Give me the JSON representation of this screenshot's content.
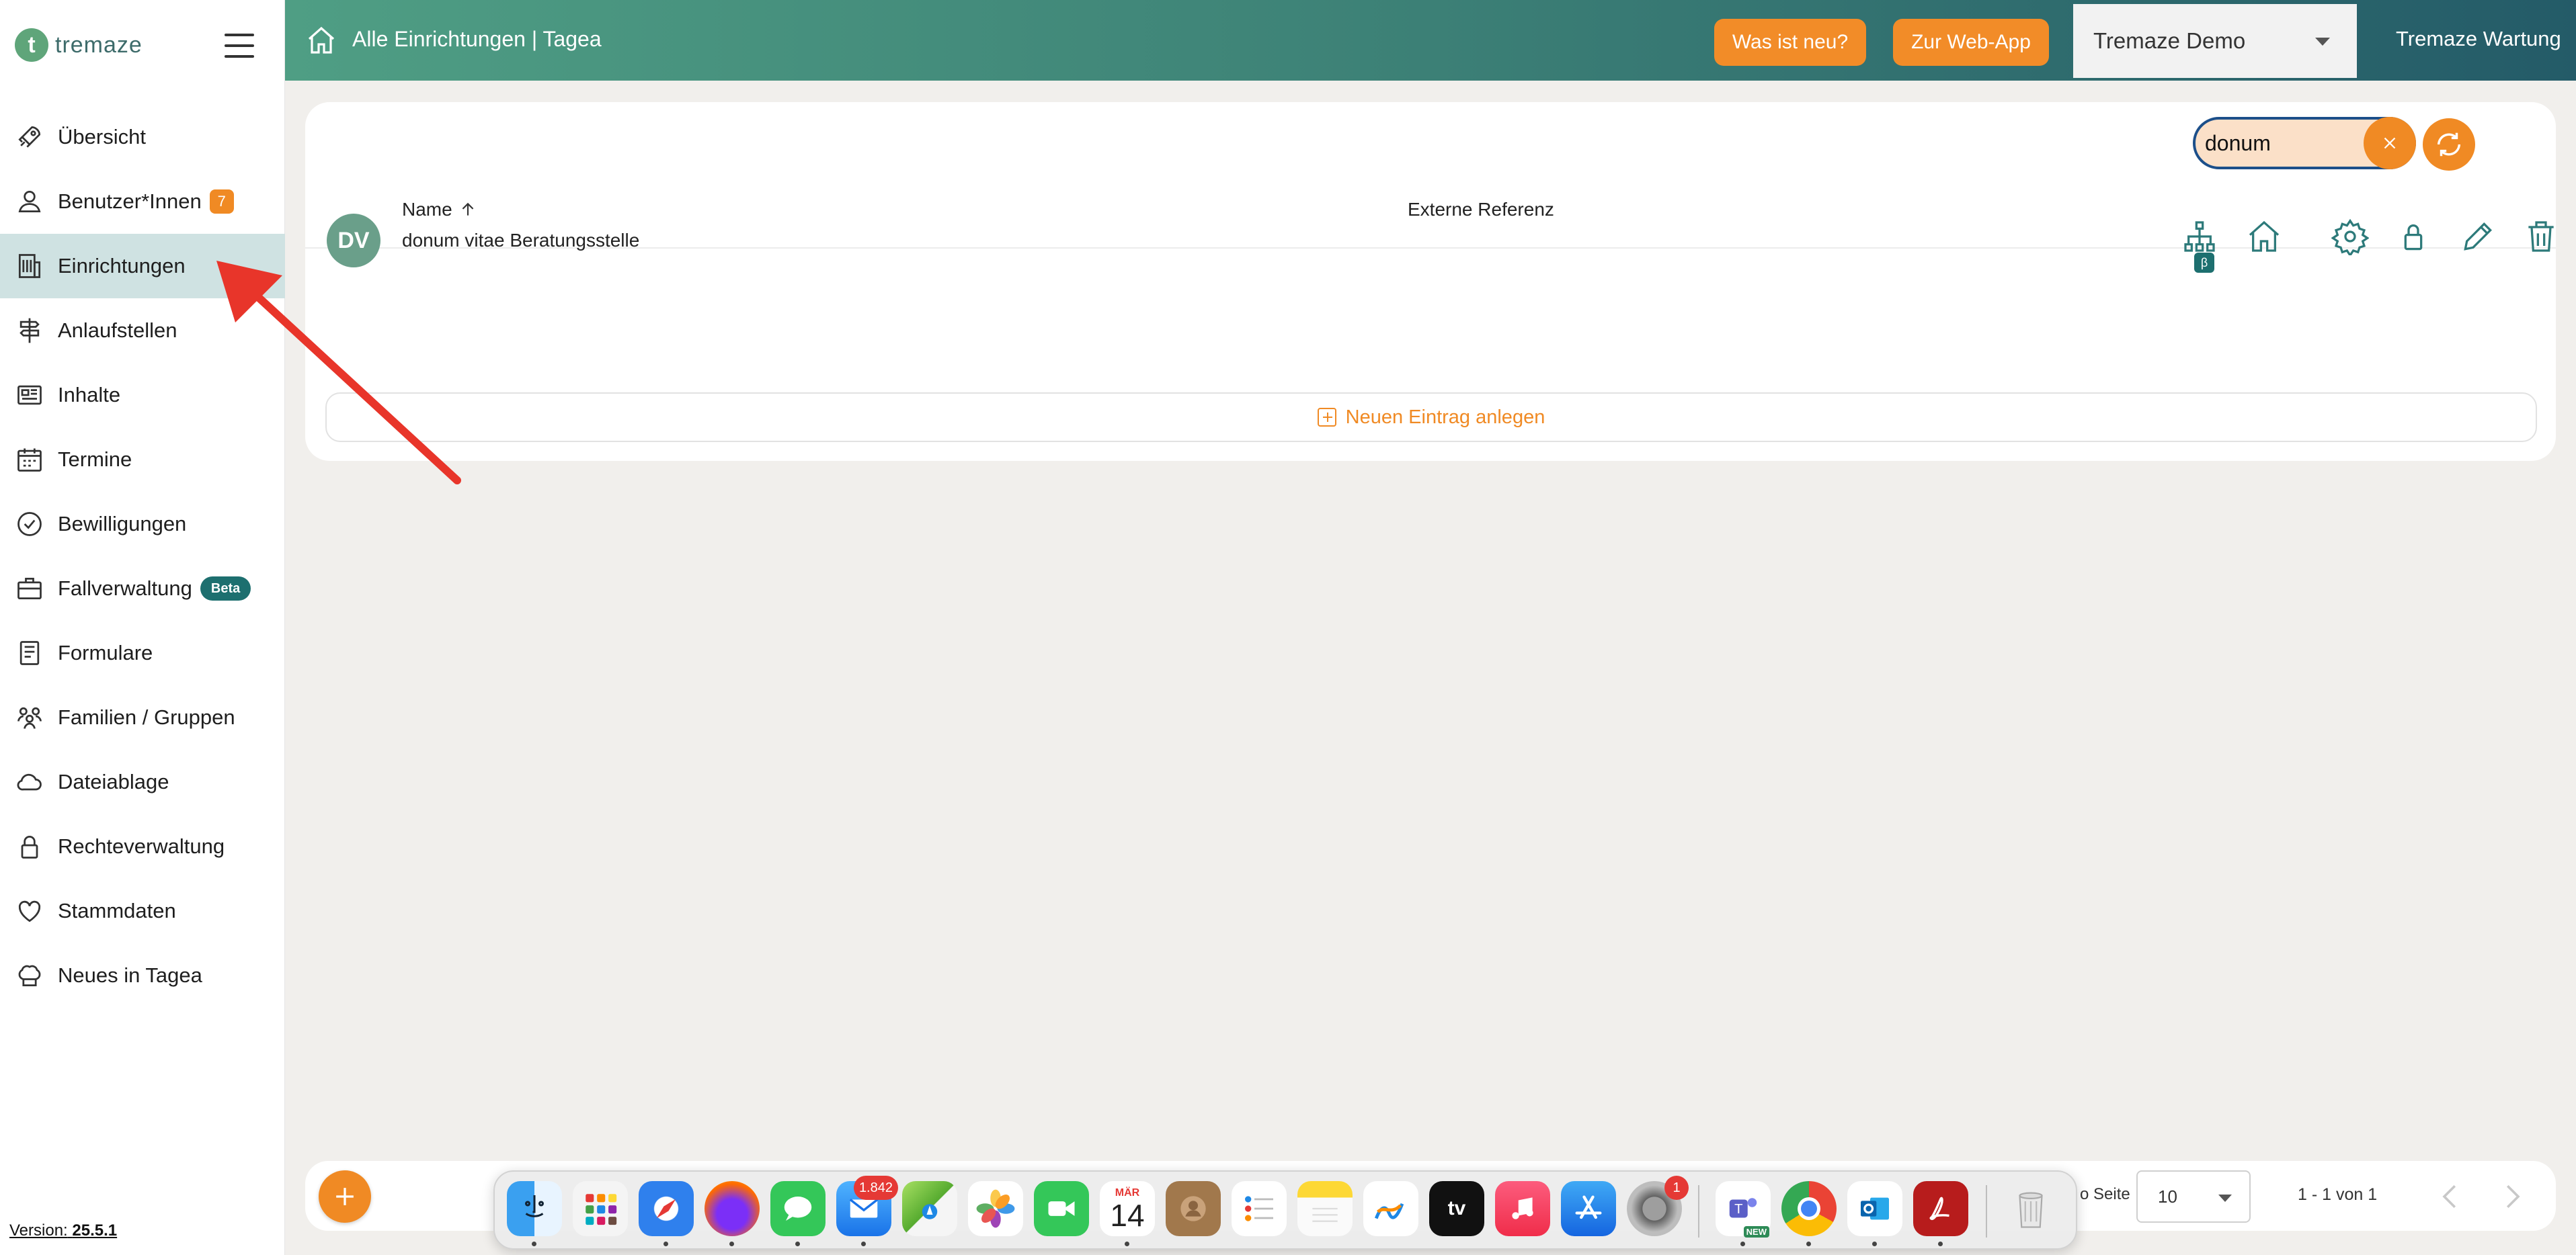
{
  "app": {
    "logo_letter": "t",
    "logo_text": "tremaze",
    "version_label": "Version:",
    "version_value": "25.5.1"
  },
  "sidebar": {
    "items": [
      {
        "label": "Übersicht",
        "icon": "rocket-icon"
      },
      {
        "label": "Benutzer*Innen",
        "icon": "user-icon",
        "badge": "7"
      },
      {
        "label": "Einrichtungen",
        "icon": "building-icon",
        "active": true
      },
      {
        "label": "Anlaufstellen",
        "icon": "signpost-icon"
      },
      {
        "label": "Inhalte",
        "icon": "newspaper-icon"
      },
      {
        "label": "Termine",
        "icon": "calendar-icon"
      },
      {
        "label": "Bewilligungen",
        "icon": "check-circle-icon"
      },
      {
        "label": "Fallverwaltung",
        "icon": "briefcase-icon",
        "badge_beta": "Beta"
      },
      {
        "label": "Formulare",
        "icon": "document-icon"
      },
      {
        "label": "Familien / Gruppen",
        "icon": "group-icon"
      },
      {
        "label": "Dateiablage",
        "icon": "cloud-icon"
      },
      {
        "label": "Rechteverwaltung",
        "icon": "lock-icon"
      },
      {
        "label": "Stammdaten",
        "icon": "heart-icon"
      },
      {
        "label": "Neues in Tagea",
        "icon": "chef-hat-icon"
      }
    ]
  },
  "header": {
    "title": "Alle Einrichtungen | Tagea",
    "btn_news": "Was ist neu?",
    "btn_webapp": "Zur Web-App",
    "tenant": "Tremaze Demo",
    "user": "Tremaze Wartung"
  },
  "search": {
    "value": "donum"
  },
  "table": {
    "columns": {
      "name": "Name",
      "reference": "Externe Referenz"
    },
    "rows": [
      {
        "initials": "DV",
        "name": "donum vitae Beratungsstelle",
        "reference": ""
      }
    ],
    "beta_mark": "β",
    "new_entry_label": "Neuen Eintrag anlegen"
  },
  "pagination": {
    "per_page_label": "o Seite",
    "per_page_value": "10",
    "range": "1 - 1 von 1"
  },
  "dock": {
    "apps": [
      {
        "name": "finder"
      },
      {
        "name": "launchpad"
      },
      {
        "name": "safari"
      },
      {
        "name": "firefox"
      },
      {
        "name": "messages"
      },
      {
        "name": "mail",
        "badge": "1.842"
      },
      {
        "name": "maps"
      },
      {
        "name": "photos"
      },
      {
        "name": "facetime"
      },
      {
        "name": "calendar",
        "month": "MÄR",
        "day": "14"
      },
      {
        "name": "contacts"
      },
      {
        "name": "reminders"
      },
      {
        "name": "notes"
      },
      {
        "name": "freeform"
      },
      {
        "name": "appletv",
        "label": "tv"
      },
      {
        "name": "music"
      },
      {
        "name": "appstore"
      },
      {
        "name": "system-settings",
        "badge": "1"
      },
      {
        "name": "teams",
        "label": "NEW"
      },
      {
        "name": "chrome"
      },
      {
        "name": "outlook"
      },
      {
        "name": "acrobat"
      },
      {
        "name": "trash"
      }
    ]
  },
  "colors": {
    "accent": "#f08a24",
    "brand": "#3c8076",
    "active_bg": "#cfe2e2",
    "arrow": "#e8352a"
  }
}
